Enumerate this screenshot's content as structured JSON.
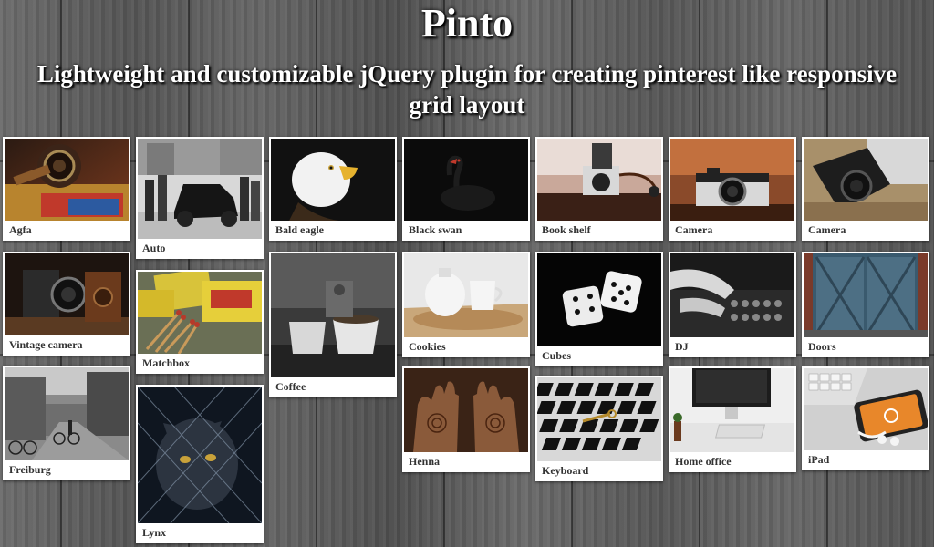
{
  "header": {
    "title": "Pinto",
    "subtitle": "Lightweight and customizable jQuery plugin for creating pinterest like responsive grid layout"
  },
  "cards": [
    {
      "caption": "Agfa",
      "image": "vintage-camera-still-life"
    },
    {
      "caption": "Vintage camera",
      "image": "antique-bellows-camera"
    },
    {
      "caption": "Freiburg",
      "image": "city-street-bicycles"
    },
    {
      "caption": "Auto",
      "image": "vintage-car-people-photo"
    },
    {
      "caption": "Matchbox",
      "image": "matchboxes"
    },
    {
      "caption": "Lynx",
      "image": "lynx-behind-fence"
    },
    {
      "caption": "Bald eagle",
      "image": "bald-eagle-head"
    },
    {
      "caption": "Coffee",
      "image": "coffee-cups-cafe"
    },
    {
      "caption": "Black swan",
      "image": "black-swan-dark"
    },
    {
      "caption": "Cookies",
      "image": "cookie-jar-mug"
    },
    {
      "caption": "Henna",
      "image": "henna-hands"
    },
    {
      "caption": "Book shelf",
      "image": "camera-on-books"
    },
    {
      "caption": "Cubes",
      "image": "dice-on-black"
    },
    {
      "caption": "Keyboard",
      "image": "keyboard-keys"
    },
    {
      "caption": "Camera",
      "image": "camera-on-books-warm"
    },
    {
      "caption": "DJ",
      "image": "dj-mixer-hands"
    },
    {
      "caption": "Home office",
      "image": "imac-desk"
    },
    {
      "caption": "Camera",
      "image": "camera-on-table"
    },
    {
      "caption": "Doors",
      "image": "blue-barn-doors"
    },
    {
      "caption": "iPad",
      "image": "phone-keyboard-earbuds"
    }
  ],
  "colors": {
    "card_background": "#ffffff",
    "caption_text": "#333333",
    "title_text": "#ffffff"
  }
}
